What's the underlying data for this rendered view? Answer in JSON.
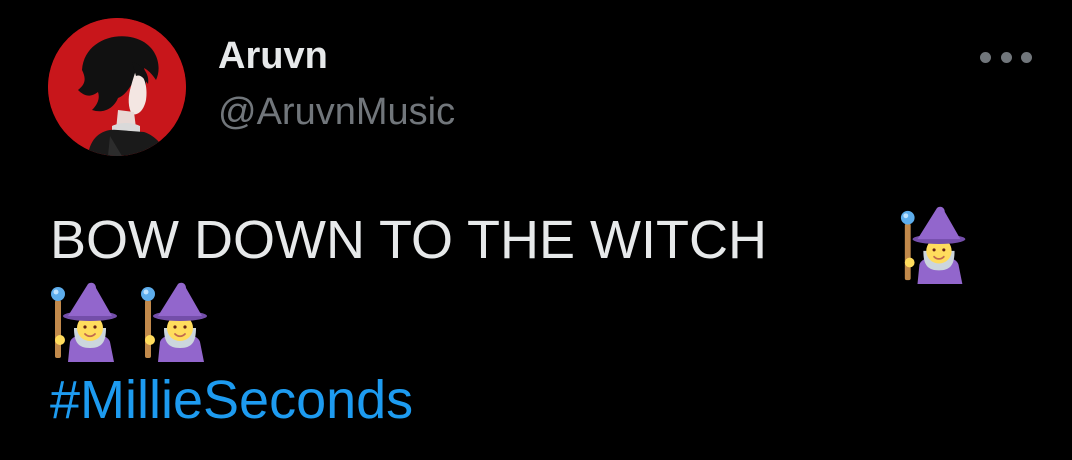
{
  "tweet": {
    "author": {
      "display_name": "Aruvn",
      "handle": "@AruvnMusic",
      "avatar_bg": "#c8161b"
    },
    "more_icon": "ellipsis-icon",
    "text": "BOW DOWN TO THE WITCH",
    "emoji": {
      "name": "woman-mage",
      "count": 3
    },
    "hashtag": "#MillieSeconds"
  },
  "colors": {
    "background": "#000000",
    "primary_text": "#e7e9ea",
    "secondary_text": "#71767b",
    "link": "#1d9bf0"
  }
}
